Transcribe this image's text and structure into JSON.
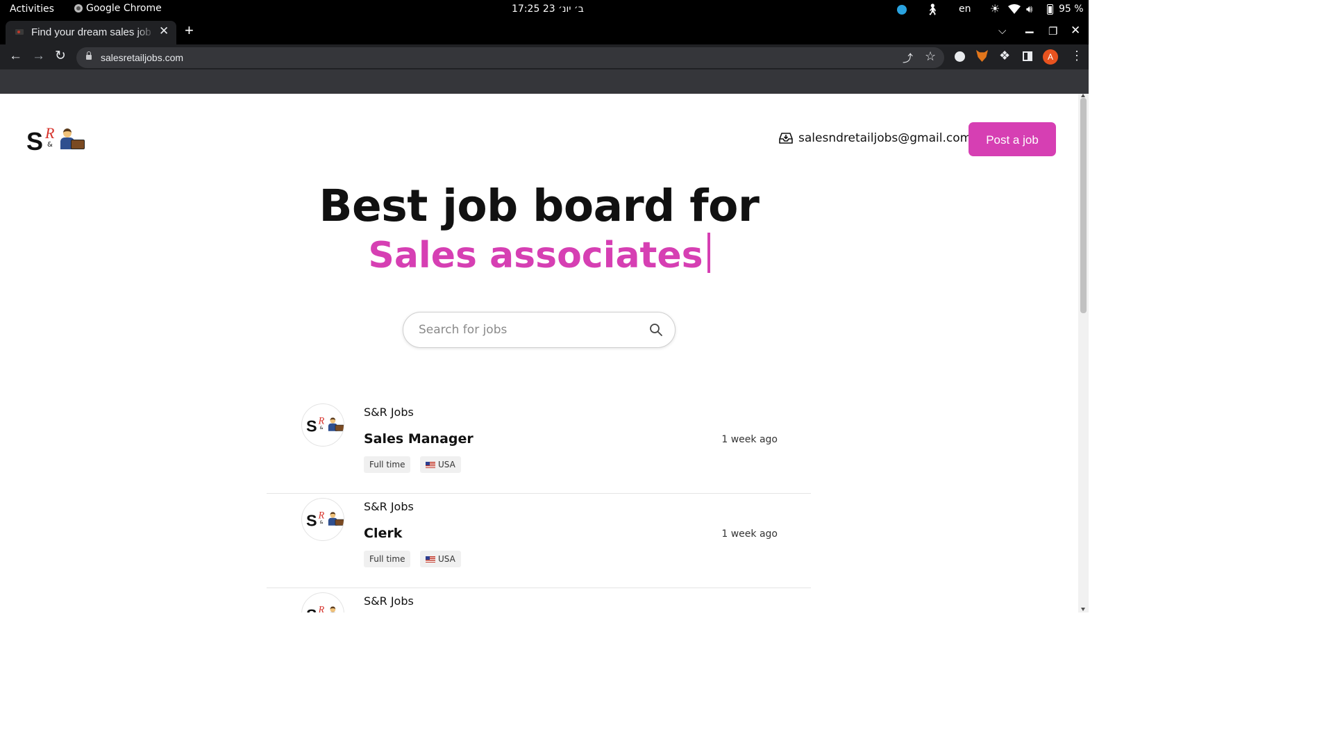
{
  "system_bar": {
    "activities": "Activities",
    "app_name": "Google Chrome",
    "clock": "ב׳ יונ׳ 23  17:25",
    "clock_visible": "ב׳ יונ׳ 23  17:25",
    "language": "en",
    "battery": "95 %"
  },
  "browser": {
    "tab_title": "Find your dream sales job",
    "url": "salesretailjobs.com"
  },
  "header": {
    "email": "salesndretailjobs@gmail.com",
    "post_job": "Post a job"
  },
  "hero": {
    "line1": "Best job board for",
    "line2": "Sales associates"
  },
  "search": {
    "placeholder": "Search for jobs"
  },
  "logo_text": {
    "s": "S",
    "r": "R",
    "amp": "&"
  },
  "jobs": [
    {
      "company": "S&R Jobs",
      "title": "Sales Manager",
      "posted": "1 week ago",
      "type": "Full time",
      "location": "USA"
    },
    {
      "company": "S&R Jobs",
      "title": "Clerk",
      "posted": "1 week ago",
      "type": "Full time",
      "location": "USA"
    },
    {
      "company": "S&R Jobs",
      "title": "",
      "posted": "",
      "type": "",
      "location": ""
    }
  ],
  "colors": {
    "accent": "#d63fb3",
    "topbar": "#000000",
    "chrome_toolbar": "#202124"
  }
}
